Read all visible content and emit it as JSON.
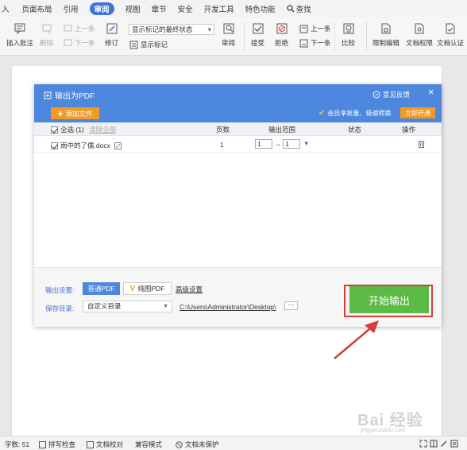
{
  "menu": {
    "tabs": [
      "入",
      "页面布局",
      "引用",
      "审阅",
      "视图",
      "章节",
      "安全",
      "开发工具",
      "特色功能",
      "查找"
    ],
    "active_index": 3
  },
  "toolbar": {
    "insert_comment": "插入批注",
    "delete": "删除",
    "prev_comment": "上一条",
    "next_comment": "下一条",
    "revise": "修订",
    "markup_select": "显示标记的最终状态",
    "show_markup": "显示标记",
    "review": "审阅",
    "accept": "接受",
    "reject": "拒绝",
    "prev_change": "上一条",
    "next_change": "下一条",
    "compare": "比较",
    "restrict_edit": "限制编辑",
    "doc_permission": "文档权限",
    "doc_auth": "文档认证"
  },
  "dialog": {
    "title": "输出为PDF",
    "feedback": "意见反馈",
    "add_file": "添加文件",
    "promo": "会员享批量、极速转换",
    "open_vip": "立即开通",
    "columns": {
      "select_all": "全选 (1)",
      "clear_all": "清除全部",
      "pages": "页数",
      "output_range": "输出范围",
      "status": "状态",
      "action": "操作"
    },
    "rows": [
      {
        "name": "雨中的了儒.docx",
        "pages": "1",
        "range_from": "1",
        "range_sep": "→",
        "range_to": "1"
      }
    ],
    "settings": {
      "output_label": "输出设置:",
      "normal_pdf": "普通PDF",
      "pure_pdf": "纯图PDF",
      "advanced": "高级设置",
      "save_label": "保存目录:",
      "save_dir": "自定义目录",
      "path": "C:\\Users\\Administrator\\Desktop\\",
      "more": "···"
    },
    "start_button": "开始输出"
  },
  "watermark": {
    "main": "Bai 经验",
    "sub": "jingyan.baidu.com"
  },
  "statusbar": {
    "word_count": "字数: 51",
    "spell_check": "拼写检查",
    "doc_proof": "文档校对",
    "compat_mode": "兼容模式",
    "unprotected": "文档未保护"
  },
  "colors": {
    "accent_blue": "#4d87de",
    "orange": "#f29a21",
    "green": "#5cba47",
    "red_highlight": "#d83c3c"
  }
}
